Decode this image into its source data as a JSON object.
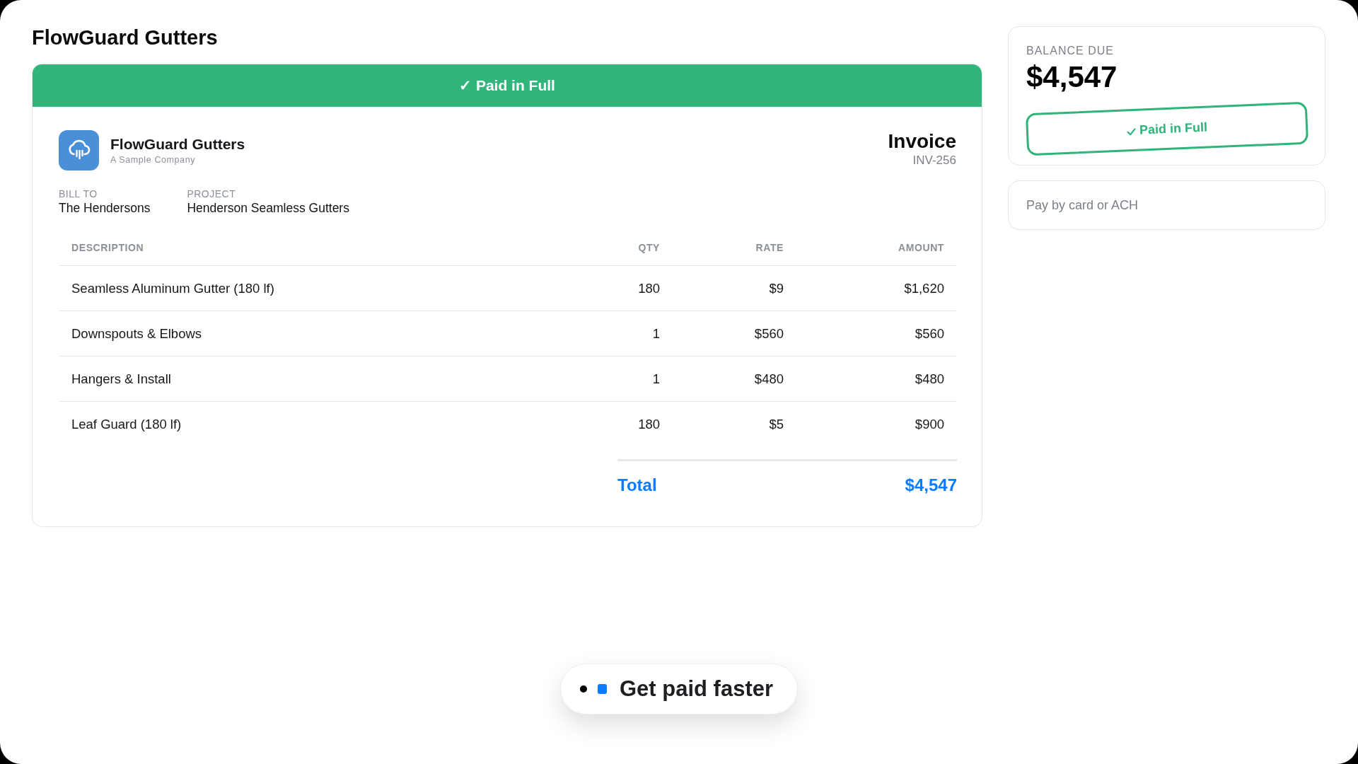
{
  "page": {
    "title": "FlowGuard Gutters"
  },
  "invoice": {
    "banner": "✓ Paid in Full",
    "company": {
      "name": "FlowGuard Gutters",
      "tagline": "A Sample Company"
    },
    "doc_title": "Invoice",
    "number": "INV-256",
    "details": [
      {
        "label": "BILL TO",
        "value": "The Hendersons"
      },
      {
        "label": "PROJECT",
        "value": "Henderson Seamless Gutters"
      }
    ],
    "table": {
      "columns": [
        "DESCRIPTION",
        "QTY",
        "RATE",
        "AMOUNT"
      ],
      "rows": [
        {
          "description": "Seamless Aluminum Gutter (180 lf)",
          "qty": "180",
          "rate": "$9",
          "amount": "$1,620"
        },
        {
          "description": "Downspouts & Elbows",
          "qty": "1",
          "rate": "$560",
          "amount": "$560"
        },
        {
          "description": "Hangers & Install",
          "qty": "1",
          "rate": "$480",
          "amount": "$480"
        },
        {
          "description": "Leaf Guard (180 lf)",
          "qty": "180",
          "rate": "$5",
          "amount": "$900"
        }
      ]
    },
    "total": {
      "label": "Total",
      "value": "$4,547"
    }
  },
  "balance": {
    "label": "BALANCE DUE",
    "amount": "$4,547",
    "stamp": "Paid in Full"
  },
  "payment": {
    "text": "Pay by card or ACH"
  },
  "callout": {
    "text": "Get paid faster"
  }
}
